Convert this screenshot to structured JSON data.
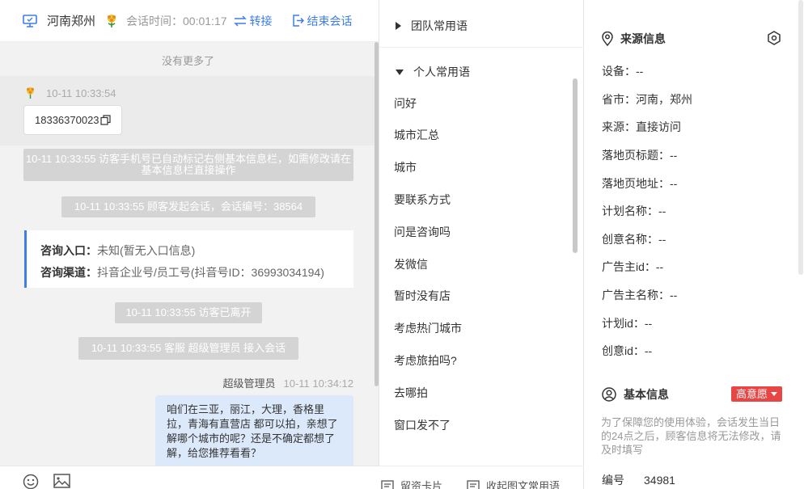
{
  "header": {
    "location": "河南郑州",
    "session_time_label": "会话时间：",
    "session_time": "00:01:17",
    "transfer_label": "转接",
    "end_label": "结束会话"
  },
  "chat": {
    "no_more": "没有更多了",
    "visitor_time": "10-11 10:33:54",
    "visitor_phone": "18336370023",
    "system_msgs": [
      "10-11 10:33:55 访客手机号已自动标记右侧基本信息栏，如需修改请在基本信息栏直接操作",
      "10-11 10:33:55 顾客发起会话，会话编号：38564",
      "10-11 10:33:55 访客已离开",
      "10-11 10:33:55 客服 超级管理员 接入会话"
    ],
    "entry_label": "咨询入口：",
    "entry_value": "未知(暂无入口信息)",
    "channel_label": "咨询渠道：",
    "channel_value": "抖音企业号/员工号(抖音号ID：36993034194)",
    "agent_name": "超级管理员",
    "agent_time": "10-11 10:34:12",
    "agent_message": "咱们在三亚，丽江，大理，香格里拉，青海有直营店 都可以拍，亲想了解哪个城市的呢？还是不确定都想了解，给您推荐看看？"
  },
  "phrases": {
    "team_group": "团队常用语",
    "personal_group": "个人常用语",
    "items": [
      "问好",
      "城市汇总",
      "城市",
      "要联系方式",
      "问是咨询吗",
      "发微信",
      "暂时没有店",
      "考虑热门城市",
      "考虑旅拍吗?",
      "去哪拍",
      "窗口发不了"
    ],
    "footer_card": "留资卡片",
    "footer_graphic": "收起图文常用语"
  },
  "source_info": {
    "title": "来源信息",
    "fields": [
      "设备：--",
      "省市：河南，郑州",
      "来源：直接访问",
      "落地页标题：--",
      "落地页地址：--",
      "计划名称：--",
      "创意名称：--",
      "广告主id：--",
      "广告主名称：--",
      "计划id：--",
      "创意id：--"
    ]
  },
  "basic_info": {
    "title": "基本信息",
    "intent_badge": "高意愿",
    "note": "为了保障您的使用体验，会话发生当日的24点之后，顾客信息将无法修改，请及时填写",
    "id_label": "编号",
    "id_value": "34981"
  },
  "colors": {
    "accent": "#3d7ee8",
    "badge": "#e84545",
    "agent_bubble": "#dce9fb"
  }
}
